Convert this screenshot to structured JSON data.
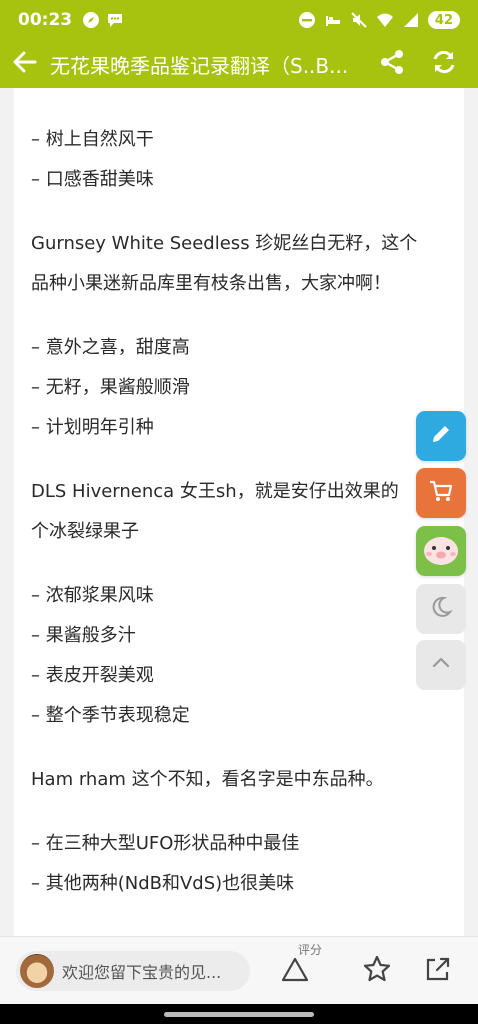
{
  "status": {
    "time": "00:23",
    "battery": "42"
  },
  "header": {
    "title": "无花果晚季品鉴记录翻译（S..B..."
  },
  "content": {
    "lines": [
      "– 树上自然风干",
      "– 口感香甜美味",
      "Gurnsey White Seedless 珍妮丝白无籽，这个",
      "品种小果迷新品库里有枝条出售，大家冲啊！",
      "– 意外之喜，甜度高",
      "– 无籽，果酱般顺滑",
      "– 计划明年引种",
      "DLS Hivernenca 女王sh，就是安仔出效果的",
      "个冰裂绿果子",
      "– 浓郁浆果风味",
      "– 果酱般多汁",
      "– 表皮开裂美观",
      "– 整个季节表现稳定",
      "Ham rham 这个不知，看名字是中东品种。",
      "– 在三种大型UFO形状品种中最佳",
      "– 其他两种(NdB和VdS)也很美味"
    ]
  },
  "bottom": {
    "comment_placeholder": "欢迎您留下宝贵的见...",
    "rate_label": "评分"
  },
  "colors": {
    "brand": "#a8c30f",
    "edit_fab": "#2eaae0",
    "cart_fab": "#e8743b",
    "sticker_fab": "#7cc04a"
  },
  "icons": [
    "back-arrow-icon",
    "share-icon",
    "refresh-icon",
    "edit-icon",
    "cart-icon",
    "sticker-icon",
    "moon-icon",
    "chevron-up-icon",
    "triangle-icon",
    "star-icon",
    "share-out-icon"
  ]
}
